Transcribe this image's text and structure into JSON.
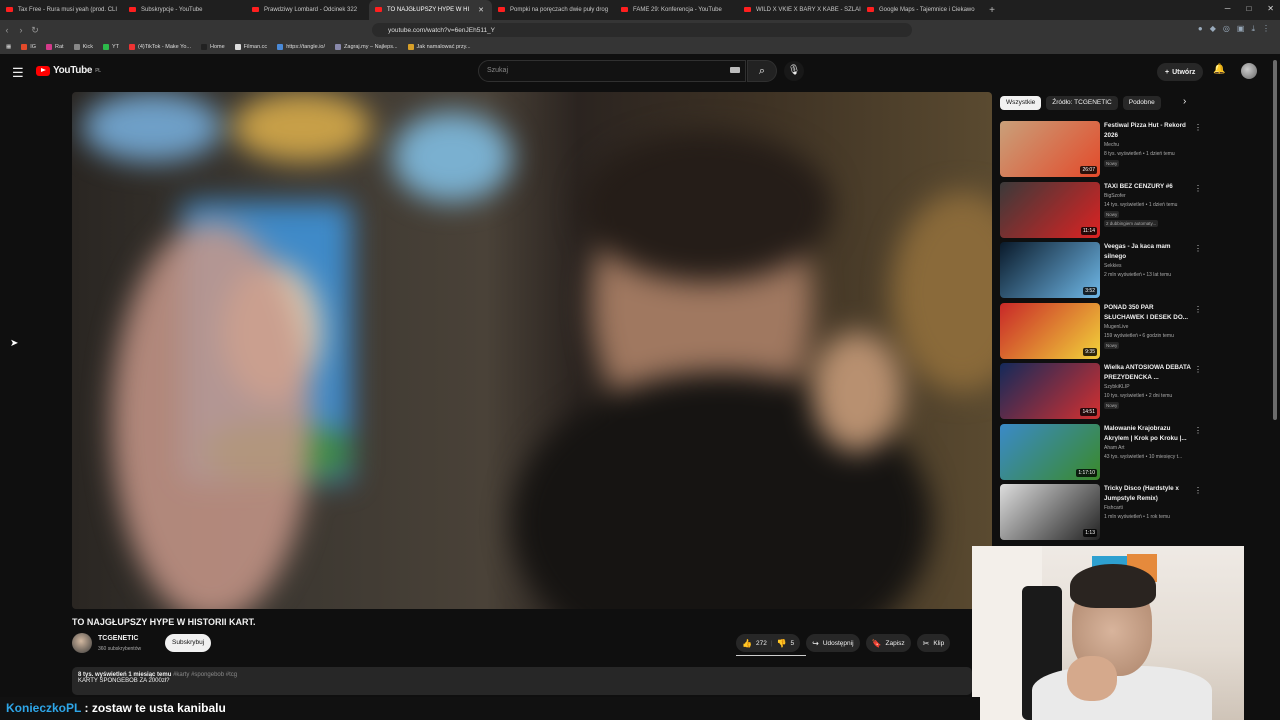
{
  "browser": {
    "tabs": [
      {
        "label": "Tax Free - Rura musi yeah (prod. CLI",
        "active": false
      },
      {
        "label": "Subskrypcje - YouTube",
        "active": false
      },
      {
        "label": "Prawdziwy Lombard - Odcinek 322",
        "active": false
      },
      {
        "label": "TO NAJGŁUPSZY HYPE W HI",
        "active": true
      },
      {
        "label": "Pompki na poręczach dwie puły drog",
        "active": false
      },
      {
        "label": "FAME 29: Konferencja - YouTube",
        "active": false
      },
      {
        "label": "WILD X VKIE X BARY X KABE - SZLAI",
        "active": false
      },
      {
        "label": "Google Maps - Tajemnice i Ciekawo",
        "active": false
      }
    ],
    "url": "youtube.com/watch?v=6enJEh511_Y",
    "bookmarks": [
      "IG",
      "Rat",
      "Kick",
      "YT",
      "(4)TikTok - Make Yo...",
      "Home",
      "Filman.cc",
      "https://tangle.io/",
      "Zagraj.my – Najleps...",
      "Jak namalować przy..."
    ]
  },
  "header": {
    "logo_text": "YouTube",
    "logo_region": "PL",
    "search_placeholder": "Szukaj",
    "create_label": "Utwórz"
  },
  "video": {
    "title": "TO NAJGŁUPSZY HYPE W HISTORII KART.",
    "channel": "TCGENETIC",
    "subscribers": "360 subskrybentów",
    "subscribe_label": "Subskrybuj",
    "likes": "272",
    "dislikes": "5",
    "share_label": "Udostępnij",
    "save_label": "Zapisz",
    "clip_label": "Klip",
    "meta": "8 tys. wyświetleń  1 miesiąc temu",
    "tags": "#karty #spongebob #tcg",
    "description": "KARTY SPONGEBOB ZA 2000zł?"
  },
  "sidebar": {
    "chips": [
      "Wszystkie",
      "Źródło: TCGENETIC",
      "Podobne"
    ],
    "recommendations": [
      {
        "title": "Festiwal Pizza Hut - Rekord 2026",
        "channel": "Mechu",
        "stats": "8 tys. wyświetleń • 1 dzień temu",
        "badge": "Nowy",
        "duration": "26:07",
        "c1": "#c9a07a",
        "c2": "#e34a2a"
      },
      {
        "title": "TAXI BEZ CENZURY #6",
        "channel": "BigSzofer",
        "stats": "14 tys. wyświetleń • 1 dzień temu",
        "badge": "Nowy",
        "extra": "2 dubbingiem automaty...",
        "duration": "11:14",
        "c1": "#3a3a3a",
        "c2": "#d22"
      },
      {
        "title": "Veegas - Ja kaca mam silnego",
        "channel": "Sekkies",
        "stats": "2 mln wyświetleń • 13 lat temu",
        "badge": "",
        "duration": "3:52",
        "c1": "#0a1a2a",
        "c2": "#6fb8e8"
      },
      {
        "title": "PONAD 350 PAR SŁUCHAWEK I DESEK DO...",
        "channel": "MugenLive",
        "stats": "159 wyświetleń • 6 godzin temu",
        "badge": "Nowy",
        "duration": "9:35",
        "c1": "#c82828",
        "c2": "#f2d33a"
      },
      {
        "title": "Wielka ANTOSIOWA DEBATA PREZYDENCKA ...",
        "channel": "SzybkiKLIP",
        "stats": "10 tys. wyświetleń • 2 dni temu",
        "badge": "Nowy",
        "duration": "14:51",
        "c1": "#142a5a",
        "c2": "#d43030"
      },
      {
        "title": "Malowanie Krajobrazu Akrylem | Krok po Kroku |...",
        "channel": "Aham Art",
        "stats": "43 tys. wyświetleń • 10 miesięcy t...",
        "badge": "",
        "duration": "1:17:10",
        "c1": "#3a8ac8",
        "c2": "#3a8a2a"
      },
      {
        "title": "Tricky Disco (Hardstyle x Jumpstyle Remix)",
        "channel": "Fishcarti",
        "stats": "1 mln wyświetleń • 1 rok temu",
        "badge": "",
        "duration": "1:13",
        "c1": "#ddd",
        "c2": "#222"
      }
    ]
  },
  "chat": {
    "user": "KonieczkoPL",
    "message": ": zostaw te usta kanibalu"
  },
  "colors": {
    "accent": "#ff0000",
    "background": "#0f0f0f",
    "chat_user": "#2ea6e8"
  }
}
